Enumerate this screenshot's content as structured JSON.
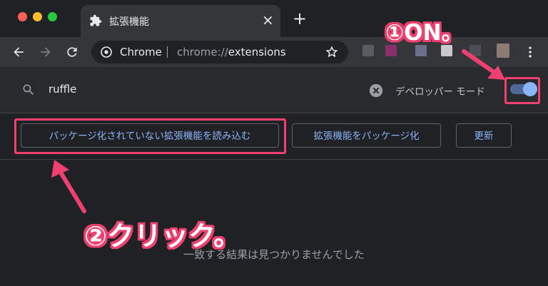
{
  "window": {
    "traffic_lights": [
      "#ff5f57",
      "#febc2e",
      "#28c840"
    ]
  },
  "tab": {
    "title": "拡張機能",
    "close": "×",
    "new_tab": "+"
  },
  "toolbar": {
    "site_name": "Chrome",
    "url_prefix": "chrome://",
    "url_path": "extensions"
  },
  "search": {
    "value": "ruffle",
    "developer_mode_label": "デベロッパー モード",
    "developer_mode_on": true
  },
  "actions": {
    "load_unpacked": "パッケージ化されていない拡張機能を読み込む",
    "pack_extension": "拡張機能をパッケージ化",
    "update": "更新"
  },
  "main": {
    "empty_message": "一致する結果は見つかりませんでした"
  },
  "annotations": {
    "step1": "①ON。",
    "step2": "②クリック。",
    "accent_color": "#f0406f"
  }
}
